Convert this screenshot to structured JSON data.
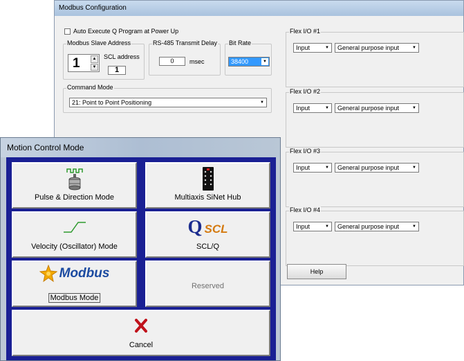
{
  "config": {
    "title": "Modbus Configuration",
    "auto_execute_label": "Auto Execute Q Program at Power Up",
    "slave": {
      "label": "Modbus Slave Address",
      "value": "1",
      "scl_label_1": "SCL",
      "scl_label_2": "address",
      "scl_value": "1"
    },
    "delay": {
      "label": "RS-485 Transmit Delay",
      "value": "0",
      "unit": "msec"
    },
    "bitrate": {
      "label": "Bit Rate",
      "value": "38400"
    },
    "command_mode": {
      "label": "Command Mode",
      "value": "21: Point to Point Positioning"
    },
    "flex": [
      {
        "label": "Flex I/O #1",
        "type": "Input",
        "function": "General purpose input"
      },
      {
        "label": "Flex I/O #2",
        "type": "Input",
        "function": "General purpose input"
      },
      {
        "label": "Flex I/O #3",
        "type": "Input",
        "function": "General purpose input"
      },
      {
        "label": "Flex I/O #4",
        "type": "Input",
        "function": "General purpose input"
      }
    ],
    "help_label": "Help"
  },
  "motion": {
    "title": "Motion Control Mode",
    "buttons": {
      "pulse": "Pulse & Direction Mode",
      "multiaxis": "Multiaxis SiNet Hub",
      "velocity": "Velocity (Oscillator) Mode",
      "sclq": "SCL/Q",
      "modbus": "Modbus Mode",
      "reserved": "Reserved",
      "cancel": "Cancel"
    },
    "logos": {
      "q": "Q",
      "scl": "SCL",
      "modbus": "Modbus"
    }
  },
  "colors": {
    "panel": "#1a2094",
    "selection": "#3399ff",
    "cancel_x": "#c0121b"
  }
}
